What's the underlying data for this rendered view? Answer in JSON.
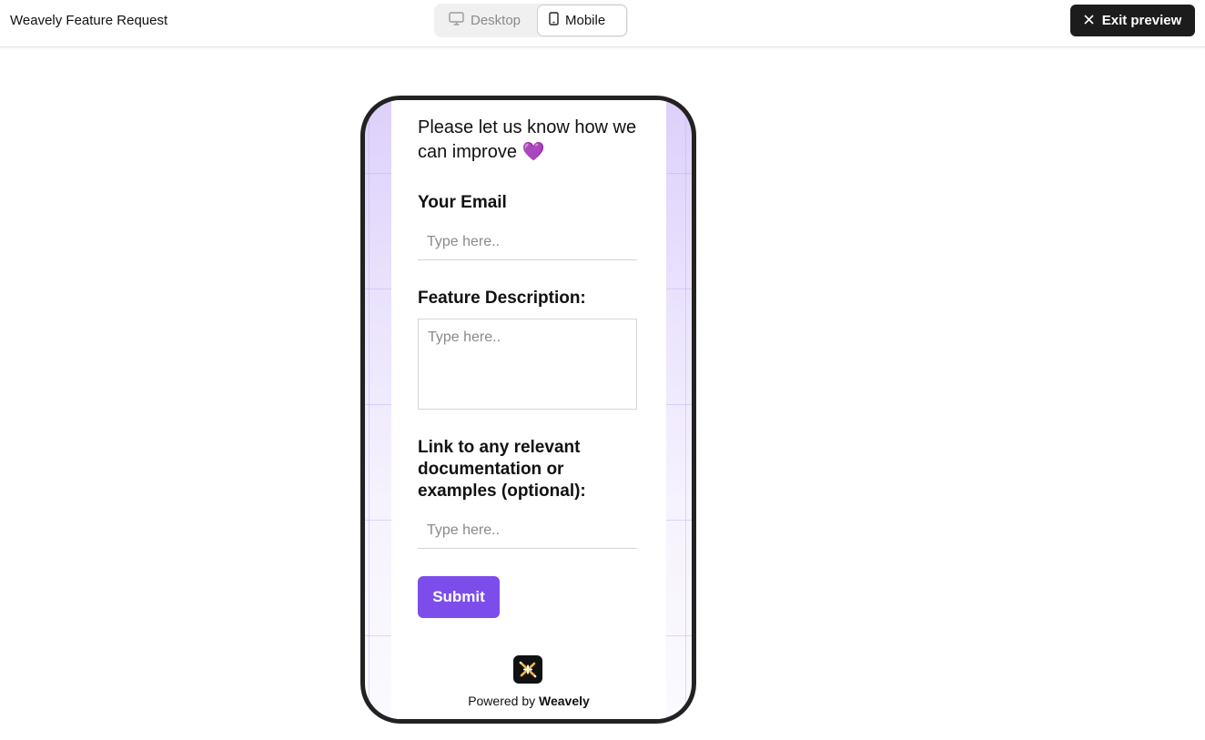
{
  "topbar": {
    "title": "Weavely Feature Request",
    "view_toggle": {
      "desktop_label": "Desktop",
      "mobile_label": "Mobile",
      "selected": "Mobile"
    },
    "exit_label": "Exit preview"
  },
  "form": {
    "heading": "Please let us know how we can improve 💜",
    "fields": [
      {
        "label": "Your Email",
        "placeholder": "Type here..",
        "value": ""
      },
      {
        "label": "Feature Description:",
        "placeholder": "Type here..",
        "value": ""
      },
      {
        "label": "Link to any relevant documentation or examples (optional):",
        "placeholder": "Type here..",
        "value": ""
      }
    ],
    "submit_label": "Submit"
  },
  "footer": {
    "powered_prefix": "Powered by",
    "brand": "Weavely"
  },
  "colors": {
    "accent": "#7c4dea",
    "dark_button": "#1c1c1c",
    "phone_bg_top": "#ddd0fb"
  }
}
